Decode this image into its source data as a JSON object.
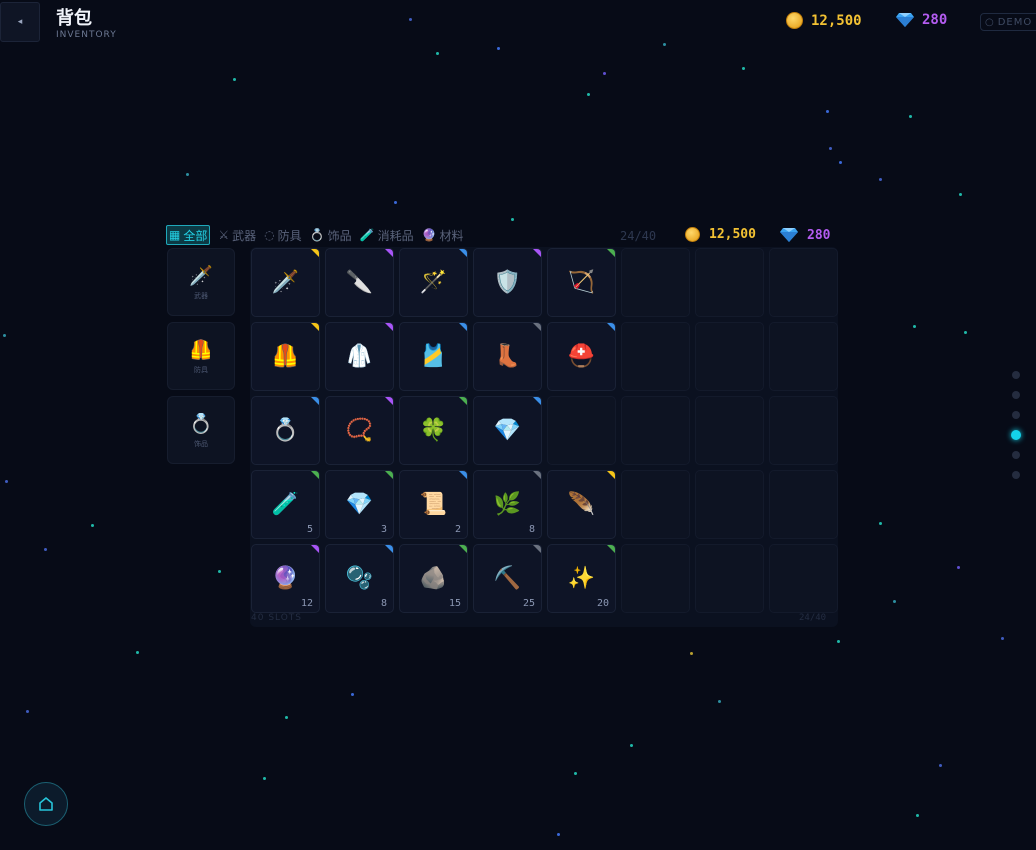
{
  "header": {
    "back_icon": "◂",
    "title": "背包",
    "subtitle": "INVENTORY",
    "gold": "12,500",
    "gems": "280",
    "demo": "DEMO"
  },
  "tabs": [
    {
      "icon": "▦",
      "label": "全部"
    },
    {
      "icon": "⚔",
      "label": "武器"
    },
    {
      "icon": "◌",
      "label": "防具"
    },
    {
      "icon": "💍",
      "label": "饰品"
    },
    {
      "icon": "🧪",
      "label": "消耗品"
    },
    {
      "icon": "🔮",
      "label": "材料"
    }
  ],
  "panel": {
    "counter": "24/40",
    "gold": "12,500",
    "gems": "280",
    "slots_label": "40 SLOTS",
    "slots_count": "24/40"
  },
  "side_categories": [
    {
      "icon": "🗡️",
      "label": "武器"
    },
    {
      "icon": "🦺",
      "label": "防具"
    },
    {
      "icon": "💍",
      "label": "饰品"
    }
  ],
  "colors": {
    "accent": "#14d3ea",
    "gold": "#f3c233",
    "gem": "#b35cf0",
    "rarity_legendary": "#f5c518",
    "rarity_epic": "#a855f7",
    "rarity_rare": "#3b8fe8",
    "rarity_uncommon": "#4caf50",
    "rarity_common": "#6b7280"
  },
  "grid": {
    "columns": 8,
    "rows": 5,
    "items": [
      {
        "icon": "🗡️",
        "rarity": "legendary",
        "qty": ""
      },
      {
        "icon": "🔪",
        "rarity": "epic",
        "qty": ""
      },
      {
        "icon": "🪄",
        "rarity": "rare",
        "qty": ""
      },
      {
        "icon": "🛡️",
        "rarity": "epic",
        "qty": ""
      },
      {
        "icon": "🏹",
        "rarity": "uncommon",
        "qty": ""
      },
      {
        "icon": "🦺",
        "rarity": "legendary",
        "qty": ""
      },
      {
        "icon": "🥼",
        "rarity": "epic",
        "qty": ""
      },
      {
        "icon": "🎽",
        "rarity": "rare",
        "qty": ""
      },
      {
        "icon": "👢",
        "rarity": "common",
        "qty": ""
      },
      {
        "icon": "⛑️",
        "rarity": "rare",
        "qty": ""
      },
      {
        "icon": "💍",
        "rarity": "rare",
        "qty": ""
      },
      {
        "icon": "📿",
        "rarity": "epic",
        "qty": ""
      },
      {
        "icon": "🍀",
        "rarity": "uncommon",
        "qty": ""
      },
      {
        "icon": "💎",
        "rarity": "rare",
        "qty": ""
      },
      {
        "icon": "🧪",
        "rarity": "uncommon",
        "qty": "5"
      },
      {
        "icon": "💎",
        "rarity": "uncommon",
        "qty": "3"
      },
      {
        "icon": "📜",
        "rarity": "rare",
        "qty": "2"
      },
      {
        "icon": "🌿",
        "rarity": "common",
        "qty": "8"
      },
      {
        "icon": "🪶",
        "rarity": "legendary",
        "qty": ""
      },
      {
        "icon": "🔮",
        "rarity": "epic",
        "qty": "12"
      },
      {
        "icon": "🫧",
        "rarity": "rare",
        "qty": "8"
      },
      {
        "icon": "🪨",
        "rarity": "uncommon",
        "qty": "15"
      },
      {
        "icon": "⛏️",
        "rarity": "common",
        "qty": "25"
      },
      {
        "icon": "✨",
        "rarity": "uncommon",
        "qty": "20"
      }
    ],
    "layout_rows": [
      5,
      5,
      4,
      5,
      5
    ]
  },
  "pagination": {
    "total": 6,
    "active": 3
  },
  "home_icon": "⌂"
}
